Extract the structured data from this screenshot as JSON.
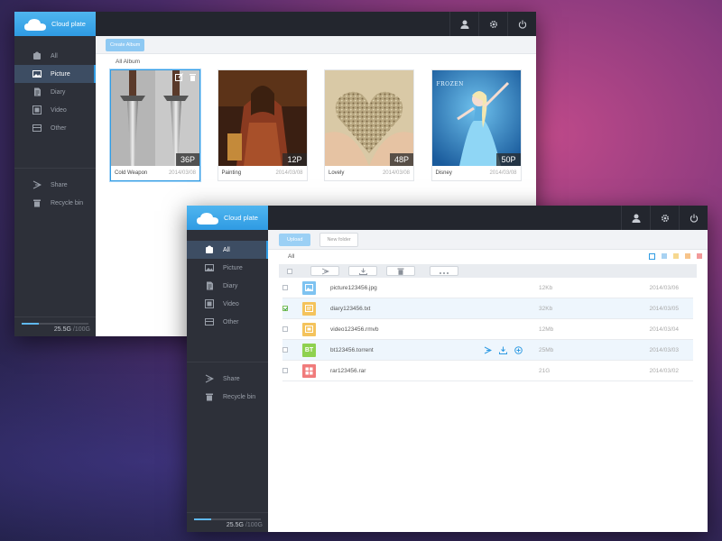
{
  "theme": {
    "accent": "#2f9be3",
    "sidebar_bg": "#2d3039",
    "topbar_bg": "#23262e",
    "active_item_bg": "#3d4d63",
    "icon_colors": {
      "image": "#7ec3f1",
      "text": "#f4c35c",
      "video": "#f4c35c",
      "torrent": "#8fd14f",
      "archive": "#f07b7b"
    }
  },
  "window1": {
    "logo": "Cloud plate",
    "topbar_icons": [
      "user-icon",
      "gear-icon",
      "power-icon"
    ],
    "sidebar": {
      "items": [
        {
          "label": "All",
          "icon": "all-files-icon",
          "active": false
        },
        {
          "label": "Picture",
          "icon": "picture-icon",
          "active": true
        },
        {
          "label": "Diary",
          "icon": "diary-icon",
          "active": false
        },
        {
          "label": "Video",
          "icon": "video-icon",
          "active": false
        },
        {
          "label": "Other",
          "icon": "other-icon",
          "active": false
        }
      ],
      "bottom_items": [
        {
          "label": "Share",
          "icon": "share-icon"
        },
        {
          "label": "Recycle bin",
          "icon": "trash-icon"
        }
      ],
      "storage": {
        "used": "25.5G",
        "total": " /100G",
        "fraction": 0.255
      }
    },
    "toolbar": {
      "create_label": "Create Album"
    },
    "section": "All Album",
    "albums": [
      {
        "name": "Cold Weapon",
        "date": "2014/03/08",
        "count": "36P",
        "selected": true
      },
      {
        "name": "Painting",
        "date": "2014/03/08",
        "count": "12P",
        "selected": false
      },
      {
        "name": "Lovely",
        "date": "2014/03/08",
        "count": "48P",
        "selected": false
      },
      {
        "name": "Disney",
        "date": "2014/03/08",
        "count": "50P",
        "selected": false,
        "poster_text": "FROZEN"
      }
    ]
  },
  "window2": {
    "logo": "Cloud plate",
    "topbar_icons": [
      "user-icon",
      "gear-icon",
      "power-icon"
    ],
    "sidebar": {
      "items": [
        {
          "label": "All",
          "icon": "all-files-icon",
          "active": true
        },
        {
          "label": "Picture",
          "icon": "picture-icon",
          "active": false
        },
        {
          "label": "Diary",
          "icon": "diary-icon",
          "active": false
        },
        {
          "label": "Video",
          "icon": "video-icon",
          "active": false
        },
        {
          "label": "Other",
          "icon": "other-icon",
          "active": false
        }
      ],
      "bottom_items": [
        {
          "label": "Share",
          "icon": "share-icon"
        },
        {
          "label": "Recycle bin",
          "icon": "trash-icon"
        }
      ],
      "storage": {
        "used": "25.5G",
        "total": " /100G",
        "fraction": 0.255
      }
    },
    "toolbar": {
      "upload_label": "Upload",
      "new_folder_label": "New folder"
    },
    "section": "All",
    "header_actions": [
      "share-icon",
      "download-icon",
      "trash-icon",
      "more-icon"
    ],
    "files": [
      {
        "name": "picture123456.jpg",
        "size": "12Kb",
        "date": "2014/03/06",
        "type": "image",
        "checked": false,
        "selected": false
      },
      {
        "name": "diary123456.txt",
        "size": "32Kb",
        "date": "2014/03/05",
        "type": "text",
        "checked": true,
        "selected": true
      },
      {
        "name": "video123456.rmvb",
        "size": "12Mb",
        "date": "2014/03/04",
        "type": "video",
        "checked": false,
        "selected": false
      },
      {
        "name": "bt123456.torrent",
        "size": "25Mb",
        "date": "2014/03/03",
        "type": "torrent",
        "checked": false,
        "selected": true,
        "icon_text": "BT"
      },
      {
        "name": "rar123456.rar",
        "size": "21G",
        "date": "2014/03/02",
        "type": "archive",
        "checked": false,
        "selected": false
      }
    ]
  }
}
